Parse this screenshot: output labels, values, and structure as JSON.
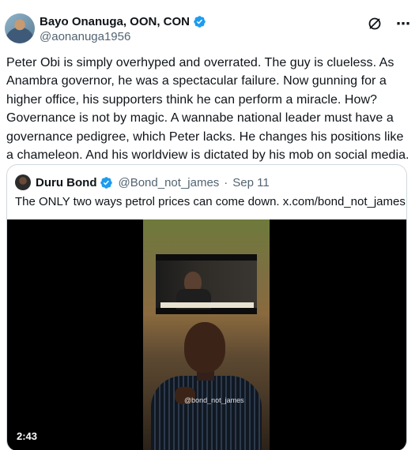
{
  "author": {
    "name": "Bayo Onanuga, OON, CON",
    "handle": "@aonanuga1956",
    "verified_icon": "verified-badge-icon",
    "avatar": "avatar"
  },
  "actions": {
    "grok_icon": "grok-icon",
    "more_icon": "more-options-icon",
    "more_label": "⋯"
  },
  "post": {
    "text": "Peter Obi is simply overhyped and overrated. The guy is clueless. As Anambra governor, he was a spectacular failure. Now gunning for a higher office, his supporters think he can perform a miracle. How? Governance is not by magic. A wannabe national leader must have a governance pedigree, which Peter lacks. He changes his positions like a chameleon. And his worldview is dictated by his mob on social media."
  },
  "quoted": {
    "name": "Duru Bond",
    "handle": "@Bond_not_james",
    "separator": "·",
    "date": "Sep 11",
    "text": "The ONLY two ways petrol prices can come down.  x.com/bond_not_james…",
    "video": {
      "duration": "2:43",
      "watermark": "@bond_not_james"
    }
  },
  "colors": {
    "accent": "#1d9bf0",
    "text": "#0f1419",
    "secondary": "#536471",
    "border": "#cfd9de"
  }
}
